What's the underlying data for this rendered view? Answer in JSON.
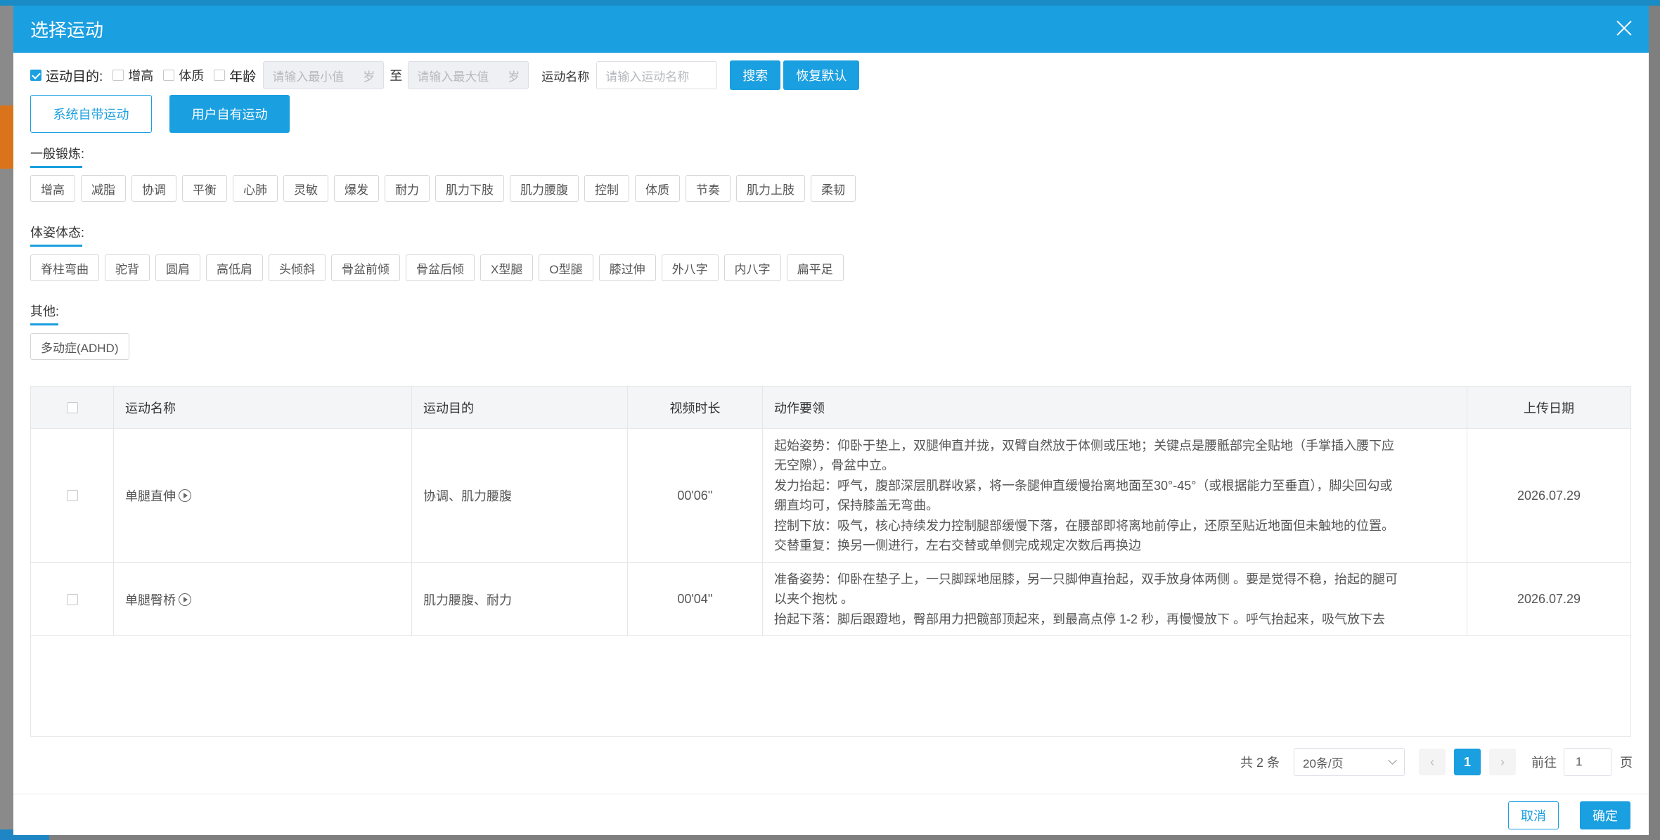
{
  "dialog": {
    "title": "选择运动"
  },
  "filters": {
    "purpose_label": "运动目的:",
    "opt_height": "增高",
    "opt_fitness": "体质",
    "age_label": "年龄",
    "min_placeholder": "请输入最小值",
    "max_placeholder": "请输入最大值",
    "unit": "岁",
    "to": "至",
    "name_label": "运动名称",
    "name_placeholder": "请输入运动名称",
    "search": "搜索",
    "reset": "恢复默认"
  },
  "sources": {
    "system": "系统自带运动",
    "user": "用户自有运动"
  },
  "sections": [
    {
      "title": "一般锻炼:",
      "tags": [
        "增高",
        "减脂",
        "协调",
        "平衡",
        "心肺",
        "灵敏",
        "爆发",
        "耐力",
        "肌力下肢",
        "肌力腰腹",
        "控制",
        "体质",
        "节奏",
        "肌力上肢",
        "柔韧"
      ]
    },
    {
      "title": "体姿体态:",
      "tags": [
        "脊柱弯曲",
        "驼背",
        "圆肩",
        "高低肩",
        "头倾斜",
        "骨盆前倾",
        "骨盆后倾",
        "X型腿",
        "O型腿",
        "膝过伸",
        "外八字",
        "内八字",
        "扁平足"
      ]
    },
    {
      "title": "其他:",
      "tags": [
        "多动症(ADHD)"
      ]
    }
  ],
  "table": {
    "headers": {
      "name": "运动名称",
      "purpose": "运动目的",
      "duration": "视频时长",
      "essentials": "动作要领",
      "date": "上传日期"
    },
    "rows": [
      {
        "name": "单腿直伸",
        "purpose": "协调、肌力腰腹",
        "duration": "00'06''",
        "lines": [
          "起始姿势：仰卧于垫上，双腿伸直并拢，双臂自然放于体侧或压地；关键点是腰骶部完全贴地（手掌插入腰下应",
          "无空隙），骨盆中立。",
          "发力抬起：呼气，腹部深层肌群收紧，将一条腿伸直缓慢抬离地面至30°-45°（或根据能力至垂直），脚尖回勾或",
          "绷直均可，保持膝盖无弯曲。",
          "控制下放：吸气，核心持续发力控制腿部缓慢下落，在腰部即将离地前停止，还原至贴近地面但未触地的位置。",
          "交替重复：换另一侧进行，左右交替或单侧完成规定次数后再换边"
        ],
        "date": "2026.07.29"
      },
      {
        "name": "单腿臀桥",
        "purpose": "肌力腰腹、耐力",
        "duration": "00'04''",
        "lines": [
          "准备姿势：仰卧在垫子上，一只脚踩地屈膝，另一只脚伸直抬起，双手放身体两侧 。要是觉得不稳，抬起的腿可",
          "以夹个抱枕 。",
          "抬起下落：脚后跟蹬地，臀部用力把髋部顶起来，到最高点停 1-2 秒，再慢慢放下 。呼气抬起来，吸气放下去"
        ],
        "date": "2026.07.29"
      }
    ]
  },
  "pagination": {
    "total": "共 2 条",
    "page_size": "20条/页",
    "prev": "‹",
    "current": "1",
    "next": "›",
    "goto_label": "前往",
    "goto_value": "1",
    "page_suffix": "页"
  },
  "footer": {
    "cancel": "取消",
    "confirm": "确定"
  }
}
